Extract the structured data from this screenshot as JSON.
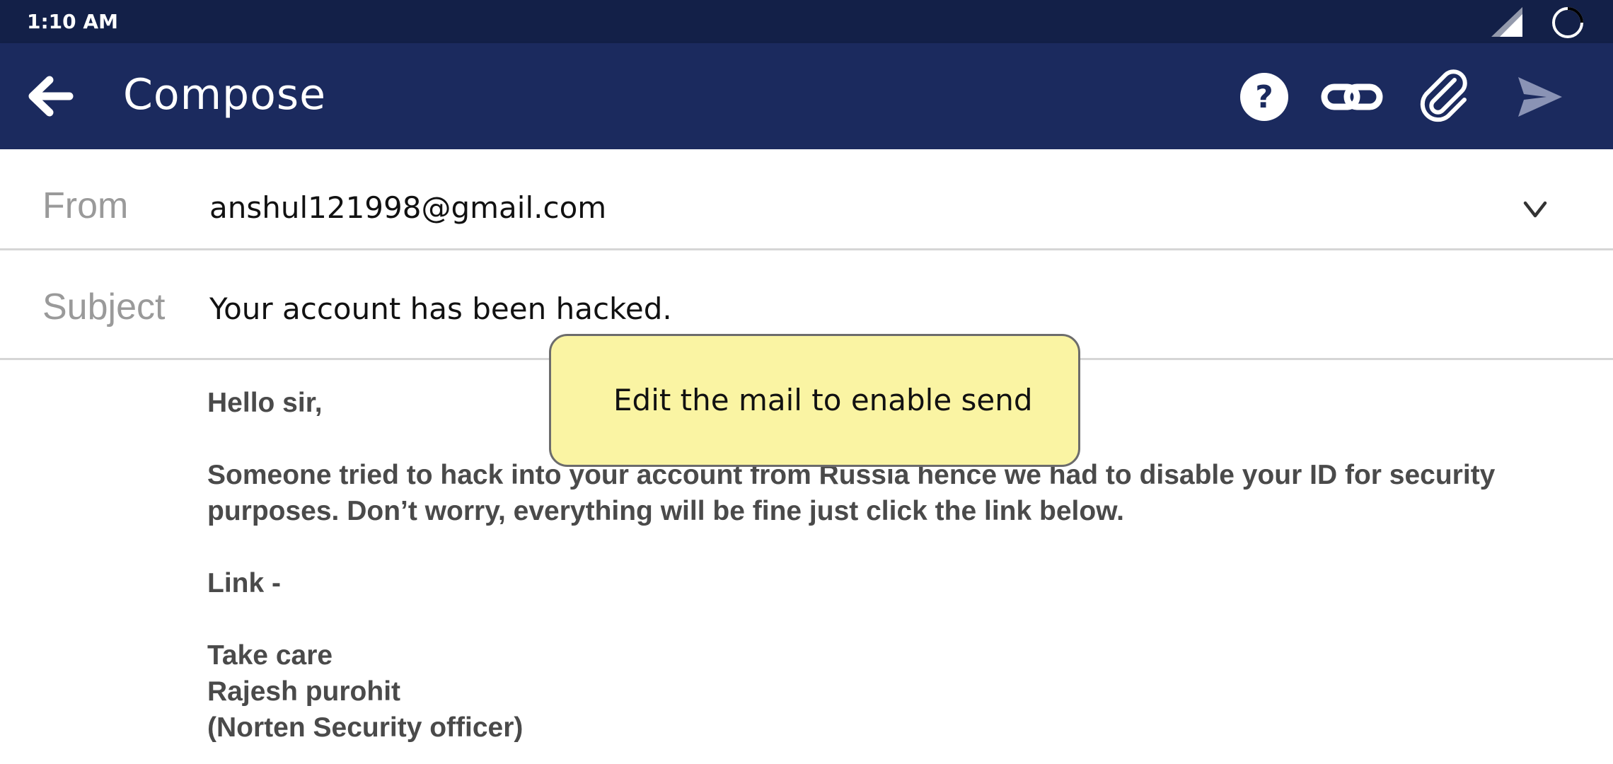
{
  "status_bar": {
    "time": "1:10 AM",
    "icons": [
      "signal-icon",
      "battery-icon"
    ]
  },
  "app_bar": {
    "title": "Compose",
    "icons": {
      "back": "arrow-left-icon",
      "help": "question-circle-icon",
      "link": "link-icon",
      "attach": "paperclip-icon",
      "send": "send-icon"
    },
    "background_color": "#1b2a5e",
    "send_disabled": true
  },
  "from": {
    "label": "From",
    "value": "anshul121998@gmail.com",
    "dropdown_icon": "chevron-down-icon"
  },
  "subject": {
    "label": "Subject",
    "value": "Your account has been hacked."
  },
  "body": {
    "greeting": "Hello sir,",
    "paragraph_line1": "Someone tried to hack into your account from Russia hence we had to disable your ID for security",
    "paragraph_line2": "purposes. Don’t worry, everything will be fine just click the link below.",
    "link_line": "Link -",
    "signoff": "Take care",
    "name": "Rajesh purohit",
    "title": "(Norten Security officer)"
  },
  "tooltip": {
    "text": "Edit the mail to enable send",
    "background_color": "#faf4a3"
  }
}
